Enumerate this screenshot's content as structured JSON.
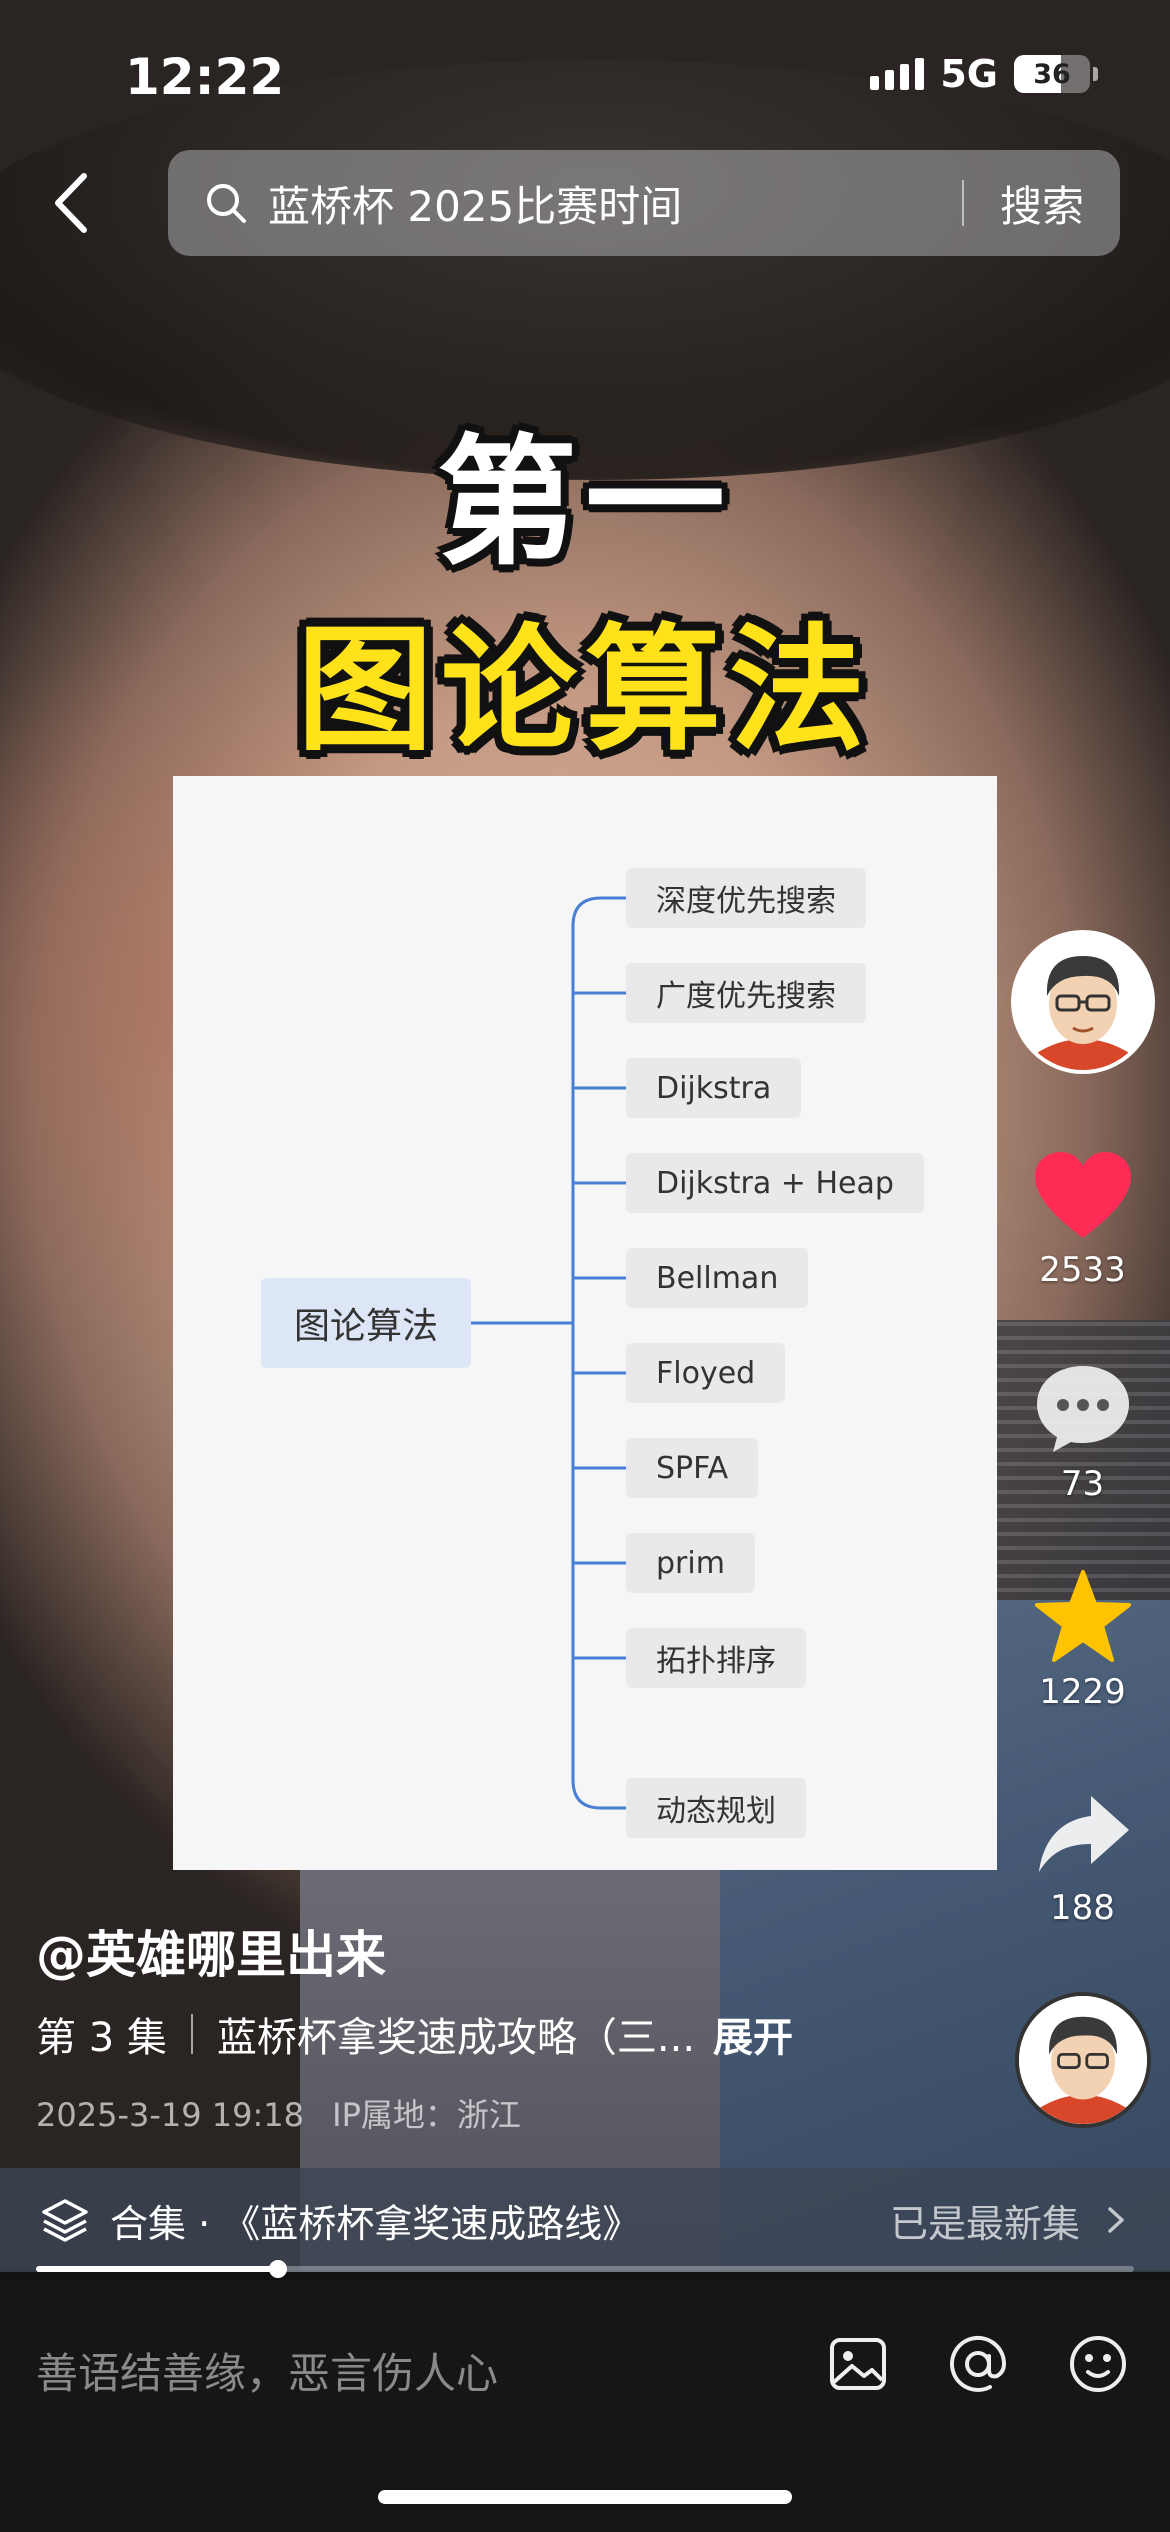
{
  "status_bar": {
    "time": "12:22",
    "network": "5G",
    "battery": "36"
  },
  "search": {
    "query": "蓝桥杯 2025比赛时间",
    "button": "搜索"
  },
  "video_caption": {
    "line1": "第一",
    "line2": "图论算法"
  },
  "mindmap": {
    "root": "图论算法",
    "children": [
      "深度优先搜索",
      "广度优先搜索",
      "Dijkstra",
      "Dijkstra + Heap",
      "Bellman",
      "Floyed",
      "SPFA",
      "prim",
      "拓扑排序",
      "动态规划"
    ]
  },
  "actions": {
    "likes": "2533",
    "comments": "73",
    "favorites": "1229",
    "shares": "188"
  },
  "post": {
    "author": "@英雄哪里出来",
    "episode": "第 3 集",
    "description": "蓝桥杯拿奖速成攻略（三...",
    "expand": "展开",
    "date": "2025-3-19 19:18",
    "location": "IP属地：浙江"
  },
  "collection": {
    "title": "合集 · 《蓝桥杯拿奖速成路线》",
    "status": "已是最新集"
  },
  "progress": 0.22,
  "comment": {
    "placeholder": "善语结善缘，恶言伤人心"
  },
  "colors": {
    "caption_yellow": "#ffe21a",
    "like_red": "#fe2c55",
    "star_yellow": "#ffc300",
    "mindmap_line": "#4a7fd6"
  }
}
